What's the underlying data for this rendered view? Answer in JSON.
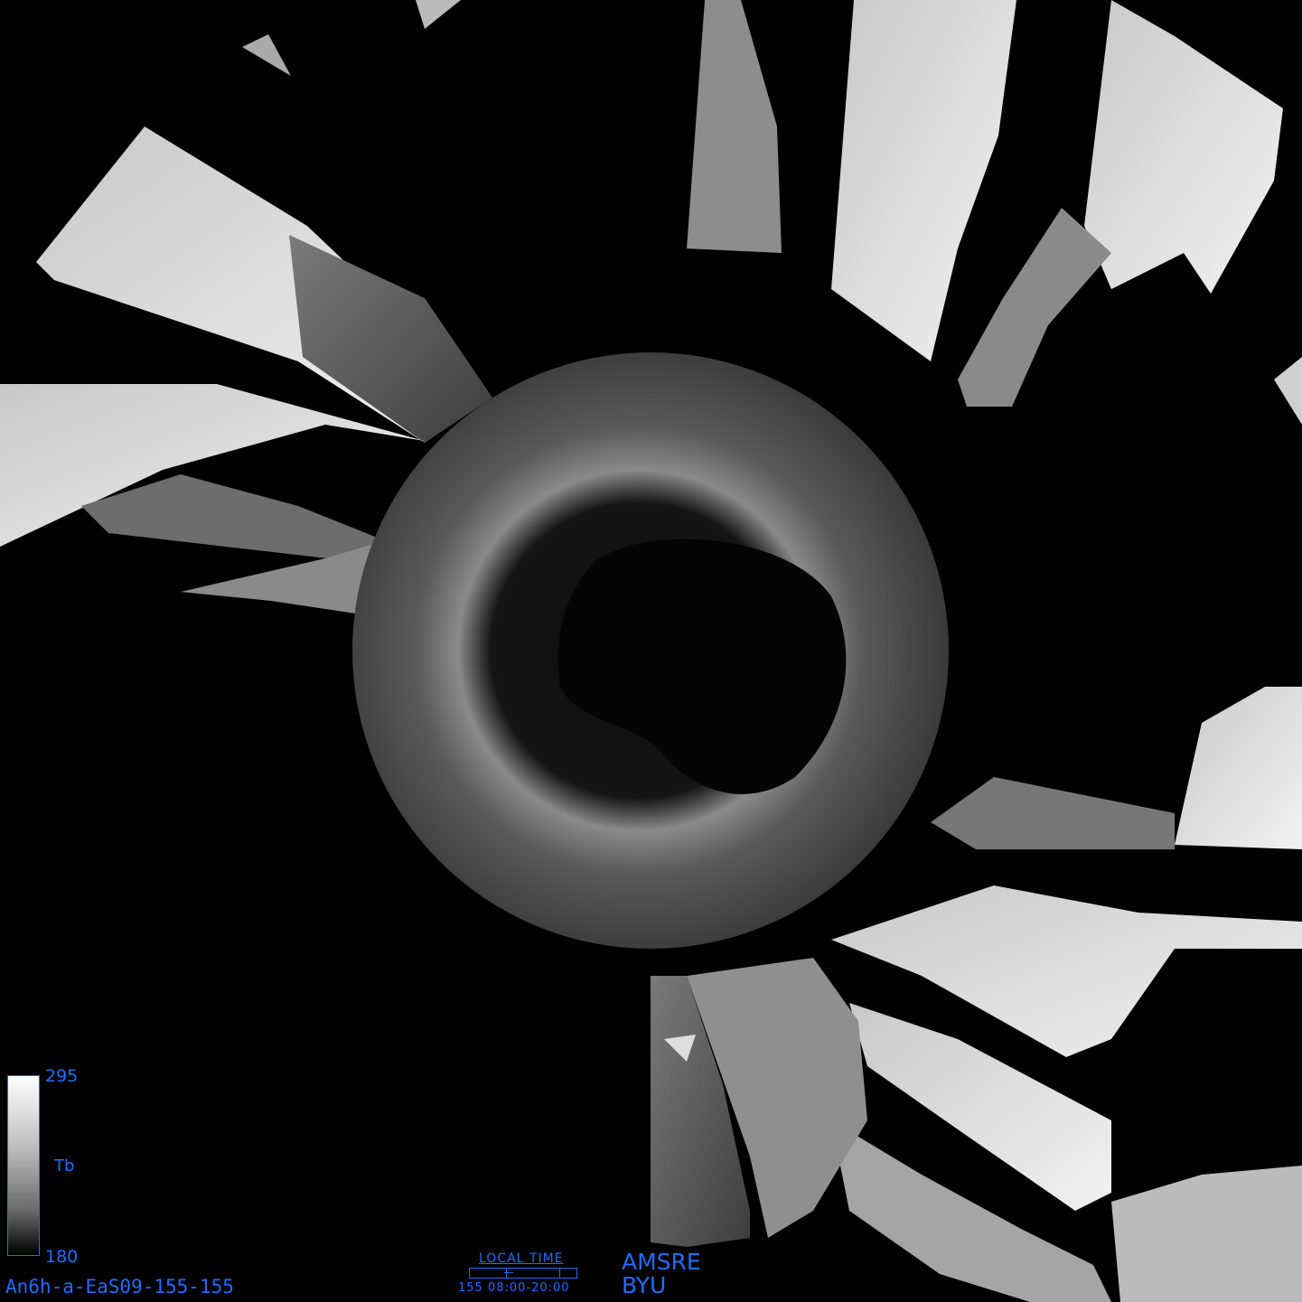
{
  "image": {
    "sensor": "AMSRE",
    "organization": "BYU",
    "file_id": "An6h-a-EaS09-155-155"
  },
  "colorbar": {
    "max_label": "295",
    "min_label": "180",
    "variable_label": "Tb",
    "colors": {
      "high": "#ffffff",
      "low": "#000000",
      "text": "#1f6cff"
    }
  },
  "local_time": {
    "title": "LOCAL TIME",
    "range_label": "155 08:00-20:00"
  },
  "map": {
    "projection_center": "south-pole",
    "land_color": "#d9d9d9",
    "ocean_color": "#5a5a5a",
    "nodata_color": "#000000"
  }
}
